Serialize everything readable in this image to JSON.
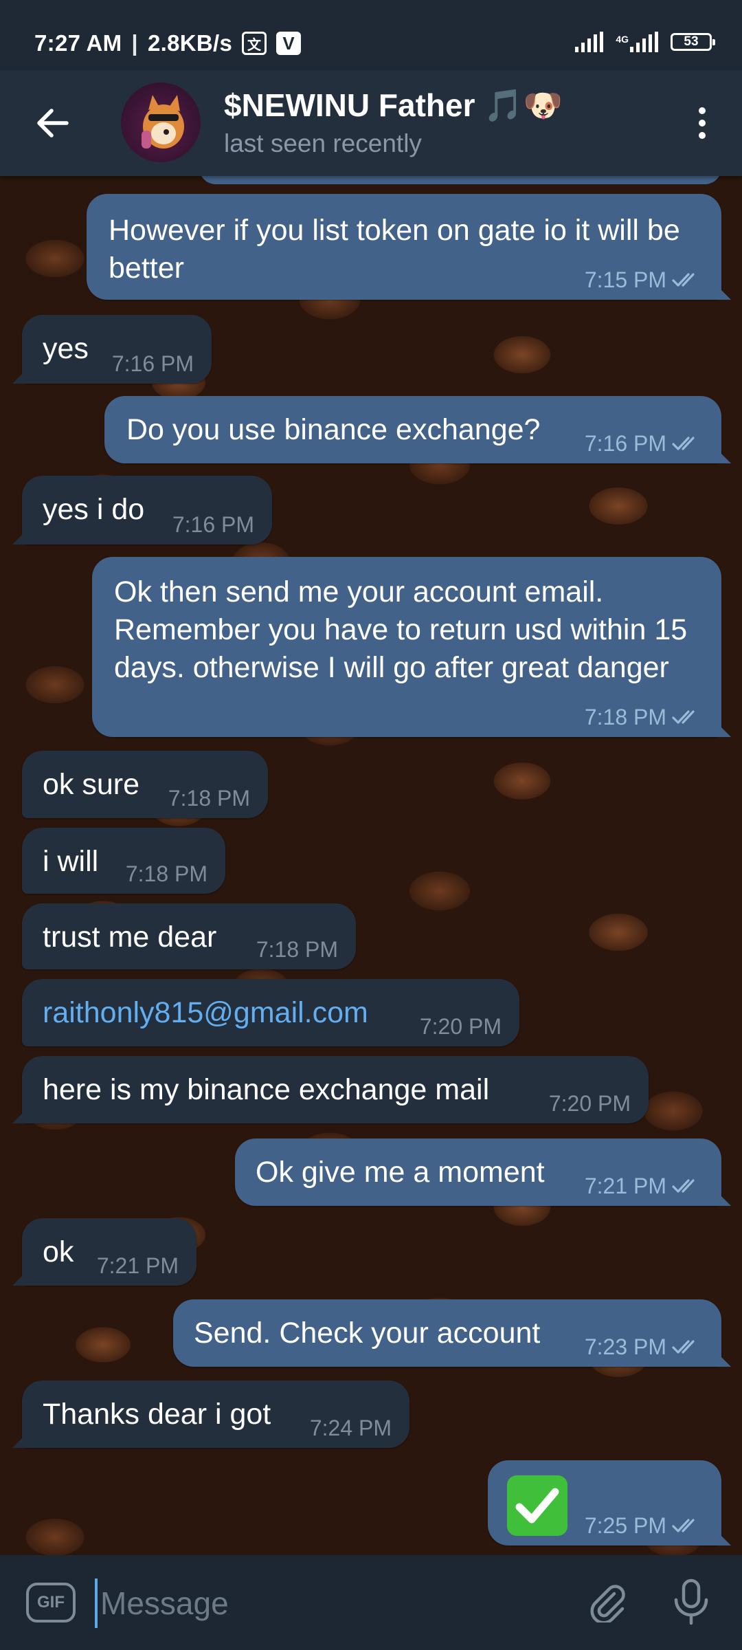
{
  "status_bar": {
    "time": "7:27 AM",
    "separator": "|",
    "speed": "2.8KB/s",
    "network": "4G",
    "battery": "53",
    "icons": [
      "translate-icon",
      "v-icon",
      "signal-icon",
      "signal-4g-icon",
      "battery-icon"
    ]
  },
  "header": {
    "title": "$NEWINU Father 🎵🐶",
    "status": "last seen recently",
    "icons": [
      "back-arrow-icon",
      "avatar",
      "more-vert-icon"
    ]
  },
  "messages": [
    {
      "dir": "out",
      "text": "However if you list token on gate io it will be better",
      "time": "7:15 PM",
      "read": true
    },
    {
      "dir": "in",
      "text": "yes",
      "time": "7:16 PM"
    },
    {
      "dir": "out",
      "text": "Do you use binance exchange?",
      "time": "7:16 PM",
      "read": true
    },
    {
      "dir": "in",
      "text": "yes i do",
      "time": "7:16 PM"
    },
    {
      "dir": "out",
      "text": "Ok then send me your account email. Remember you have to return usd within 15 days. otherwise I will go after great danger",
      "time": "7:18 PM",
      "read": true
    },
    {
      "dir": "in",
      "text": "ok sure",
      "time": "7:18 PM"
    },
    {
      "dir": "in",
      "text": "i will",
      "time": "7:18 PM"
    },
    {
      "dir": "in",
      "text": "trust me dear",
      "time": "7:18 PM"
    },
    {
      "dir": "in",
      "text": "raithonly815@gmail.com",
      "time": "7:20 PM",
      "link": true
    },
    {
      "dir": "in",
      "text": "here is my binance exchange mail",
      "time": "7:20 PM"
    },
    {
      "dir": "out",
      "text": "Ok give me a moment",
      "time": "7:21 PM",
      "read": true
    },
    {
      "dir": "in",
      "text": "ok",
      "time": "7:21 PM"
    },
    {
      "dir": "out",
      "text": "Send. Check your account",
      "time": "7:23 PM",
      "read": true
    },
    {
      "dir": "in",
      "text": "Thanks dear i got",
      "time": "7:24 PM"
    },
    {
      "dir": "out",
      "text": "✅",
      "time": "7:25 PM",
      "read": true,
      "emoji": "check-mark-emoji"
    }
  ],
  "composer": {
    "gif_label": "GIF",
    "placeholder": "Message",
    "icons": [
      "gif-icon",
      "paperclip-icon",
      "mic-icon"
    ]
  },
  "colors": {
    "outgoing_bubble": "#436289",
    "incoming_bubble": "#242f3d",
    "header_bg": "#232f3d",
    "link": "#62aef0",
    "read_check": "#9bbbd9"
  }
}
